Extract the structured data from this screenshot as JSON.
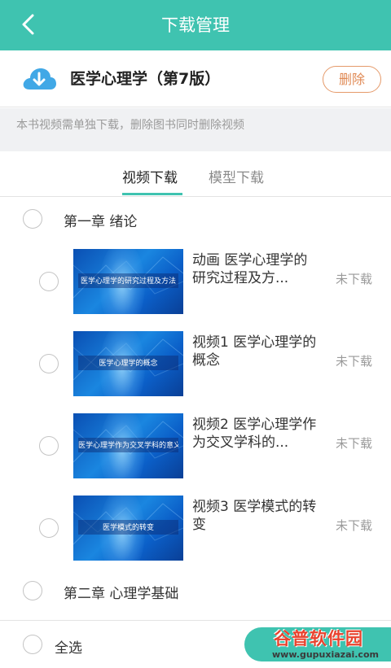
{
  "header": {
    "title": "下载管理",
    "back_icon": "chevron-left-icon"
  },
  "book": {
    "icon": "cloud-download-icon",
    "title": "医学心理学（第7版）",
    "delete_label": "删除"
  },
  "notice": "本书视频需单独下载，删除图书同时删除视频",
  "tabs": [
    {
      "label": "视频下载",
      "active": true
    },
    {
      "label": "模型下载",
      "active": false
    }
  ],
  "chapters": [
    {
      "title": "第一章  绪论",
      "videos": [
        {
          "title": "动画 医学心理学的研究过程及方...",
          "status": "未下载",
          "thumb_caption": "医学心理学的研究过程及方法"
        },
        {
          "title": "视频1 医学心理学的概念",
          "status": "未下载",
          "thumb_caption": "医学心理学的概念"
        },
        {
          "title": "视频2 医学心理学作为交叉学科的...",
          "status": "未下载",
          "thumb_caption": "医学心理学作为交叉学科的意义"
        },
        {
          "title": "视频3 医学模式的转变",
          "status": "未下载",
          "thumb_caption": "医学模式的转变"
        }
      ]
    },
    {
      "title": "第二章  心理学基础",
      "videos": []
    }
  ],
  "footer": {
    "select_all_label": "全选"
  },
  "watermark": {
    "name": "谷普软件园",
    "url": "www.gupuxiazai.com"
  },
  "colors": {
    "accent": "#3fc3b0",
    "delete": "#e08a55",
    "status": "#9a9a9a",
    "thumb": "#1a86e0"
  }
}
